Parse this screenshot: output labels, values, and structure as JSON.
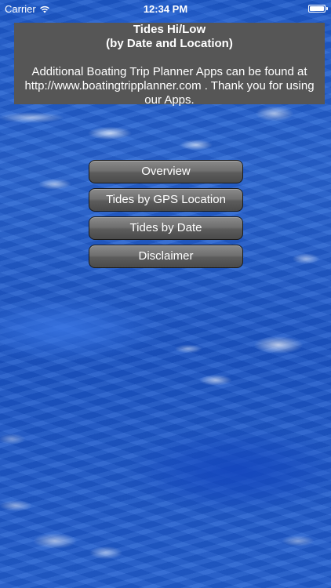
{
  "status_bar": {
    "carrier": "Carrier",
    "time": "12:34 PM",
    "icons": [
      "wifi-icon",
      "battery-icon"
    ]
  },
  "info_panel": {
    "title": "Tides Hi/Low",
    "subtitle": "(by Date and Location)",
    "body": "Additional Boating Trip Planner Apps can be found at http://www.boatingtripplanner.com . Thank you for using our Apps."
  },
  "menu": {
    "buttons": [
      {
        "label": "Overview"
      },
      {
        "label": "Tides by GPS Location"
      },
      {
        "label": "Tides by Date"
      },
      {
        "label": "Disclaimer"
      }
    ]
  },
  "colors": {
    "background_water": "#1e5ccc",
    "panel_background": "#565656",
    "button_background": "#5c5c5c",
    "text": "#ffffff"
  }
}
